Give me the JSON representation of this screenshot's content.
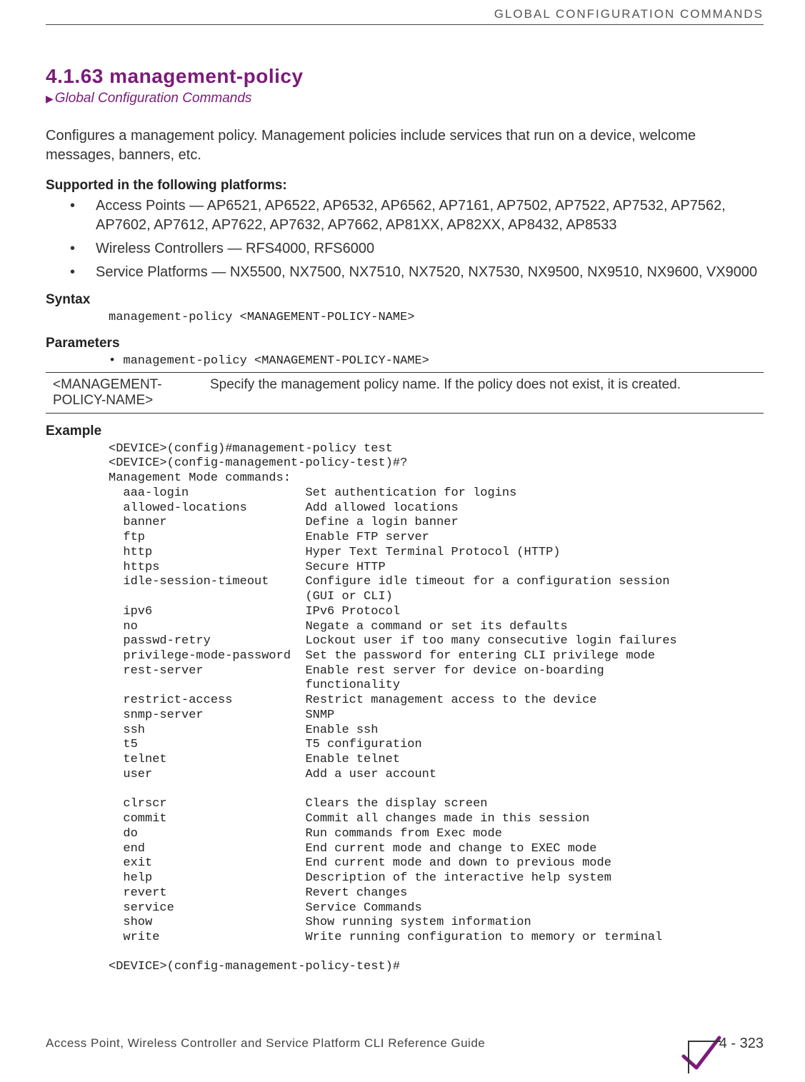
{
  "running_head": "GLOBAL CONFIGURATION COMMANDS",
  "section": {
    "number_title": "4.1.63 management-policy",
    "breadcrumb": "Global Configuration Commands"
  },
  "intro": "Configures a management policy. Management policies include services that run on a device, welcome messages, banners, etc.",
  "supported_head": "Supported in the following platforms:",
  "platforms": [
    "Access Points — AP6521, AP6522, AP6532, AP6562, AP7161, AP7502, AP7522, AP7532, AP7562, AP7602, AP7612, AP7622, AP7632, AP7662, AP81XX, AP82XX, AP8432, AP8533",
    "Wireless Controllers — RFS4000, RFS6000",
    "Service Platforms — NX5500, NX7500, NX7510, NX7520, NX7530, NX9500, NX9510, NX9600, VX9000"
  ],
  "syntax_head": "Syntax",
  "syntax_code": "management-policy <MANAGEMENT-POLICY-NAME>",
  "parameters_head": "Parameters",
  "parameters_line": "• management-policy <MANAGEMENT-POLICY-NAME>",
  "param_table": {
    "name": "<MANAGEMENT-POLICY-NAME>",
    "desc": "Specify the management policy name. If the policy does not exist, it is created."
  },
  "example_head": "Example",
  "example_code": "<DEVICE>(config)#management-policy test\n<DEVICE>(config-management-policy-test)#?\nManagement Mode commands:\n  aaa-login                Set authentication for logins\n  allowed-locations        Add allowed locations\n  banner                   Define a login banner\n  ftp                      Enable FTP server\n  http                     Hyper Text Terminal Protocol (HTTP)\n  https                    Secure HTTP\n  idle-session-timeout     Configure idle timeout for a configuration session\n                           (GUI or CLI)\n  ipv6                     IPv6 Protocol\n  no                       Negate a command or set its defaults\n  passwd-retry             Lockout user if too many consecutive login failures\n  privilege-mode-password  Set the password for entering CLI privilege mode\n  rest-server              Enable rest server for device on-boarding\n                           functionality\n  restrict-access          Restrict management access to the device\n  snmp-server              SNMP\n  ssh                      Enable ssh\n  t5                       T5 configuration\n  telnet                   Enable telnet\n  user                     Add a user account\n\n  clrscr                   Clears the display screen\n  commit                   Commit all changes made in this session\n  do                       Run commands from Exec mode\n  end                      End current mode and change to EXEC mode\n  exit                     End current mode and down to previous mode\n  help                     Description of the interactive help system\n  revert                   Revert changes\n  service                  Service Commands\n  show                     Show running system information\n  write                    Write running configuration to memory or terminal\n\n<DEVICE>(config-management-policy-test)#",
  "footer": {
    "guide": "Access Point, Wireless Controller and Service Platform CLI Reference Guide",
    "page": "4 - 323"
  }
}
